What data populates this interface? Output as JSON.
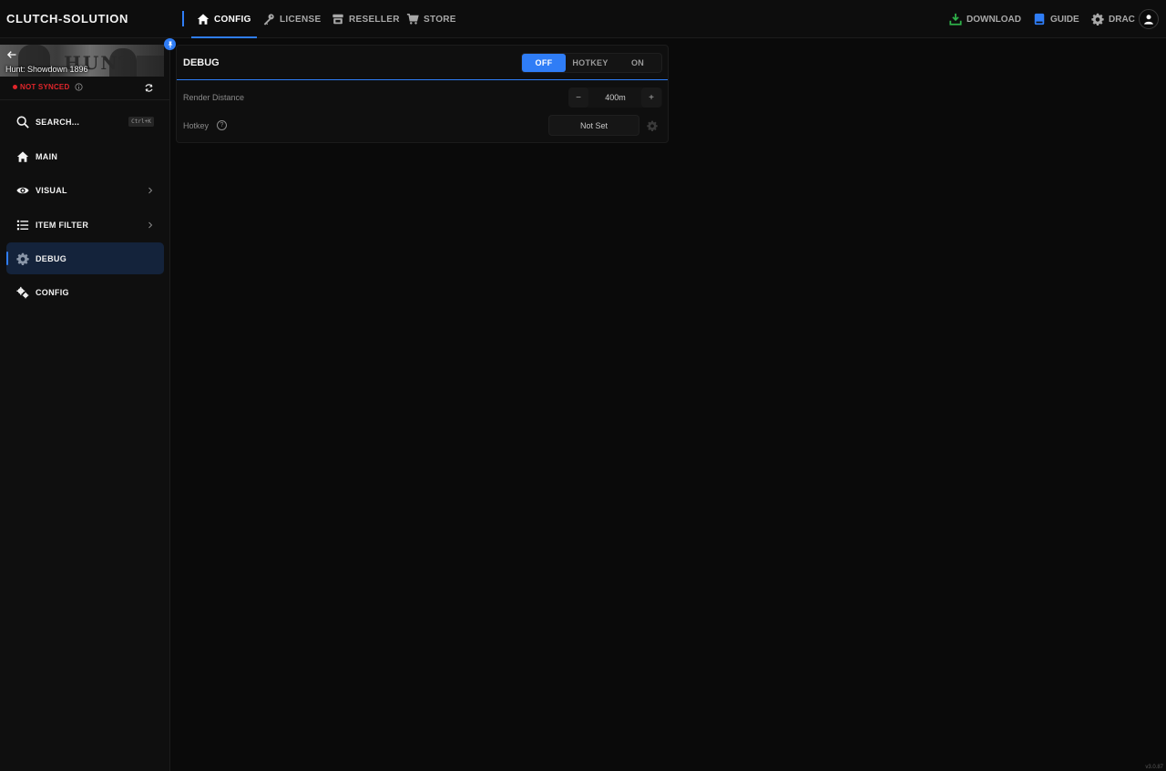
{
  "brand": "CLUTCH-SOLUTION",
  "nav": [
    {
      "label": "CONFIG",
      "icon": "home-icon",
      "active": true
    },
    {
      "label": "LICENSE",
      "icon": "key-icon",
      "active": false
    },
    {
      "label": "RESELLER",
      "icon": "store-icon",
      "active": false
    },
    {
      "label": "STORE",
      "icon": "cart-icon",
      "active": false
    }
  ],
  "topright": {
    "download": "DOWNLOAD",
    "guide": "GUIDE",
    "user": "DRAC"
  },
  "colors": {
    "accent": "#2f7df6",
    "danger": "#e0262b",
    "download": "#2fb34a",
    "guide": "#2f7df6"
  },
  "sidebar": {
    "game": "Hunt: Showdown 1896",
    "banner_logo": "HUNT",
    "sync_status": "NOT SYNCED",
    "items": [
      {
        "label": "SEARCH...",
        "icon": "search-icon",
        "shortcut": "Ctrl+K"
      },
      {
        "label": "MAIN",
        "icon": "home-icon"
      },
      {
        "label": "VISUAL",
        "icon": "eye-icon",
        "chevron": true
      },
      {
        "label": "ITEM FILTER",
        "icon": "list-icon",
        "chevron": true
      },
      {
        "label": "DEBUG",
        "icon": "gear-icon",
        "active": true
      },
      {
        "label": "CONFIG",
        "icon": "gears-icon"
      }
    ]
  },
  "panel": {
    "title": "DEBUG",
    "mode_options": [
      "OFF",
      "HOTKEY",
      "ON"
    ],
    "mode_selected": "OFF",
    "render_distance_label": "Render Distance",
    "render_distance_value": "400m",
    "stepper_minus": "−",
    "stepper_plus": "+",
    "hotkey_label": "Hotkey",
    "help_glyph": "?",
    "hotkey_value": "Not Set"
  },
  "version": "v3.0.87"
}
